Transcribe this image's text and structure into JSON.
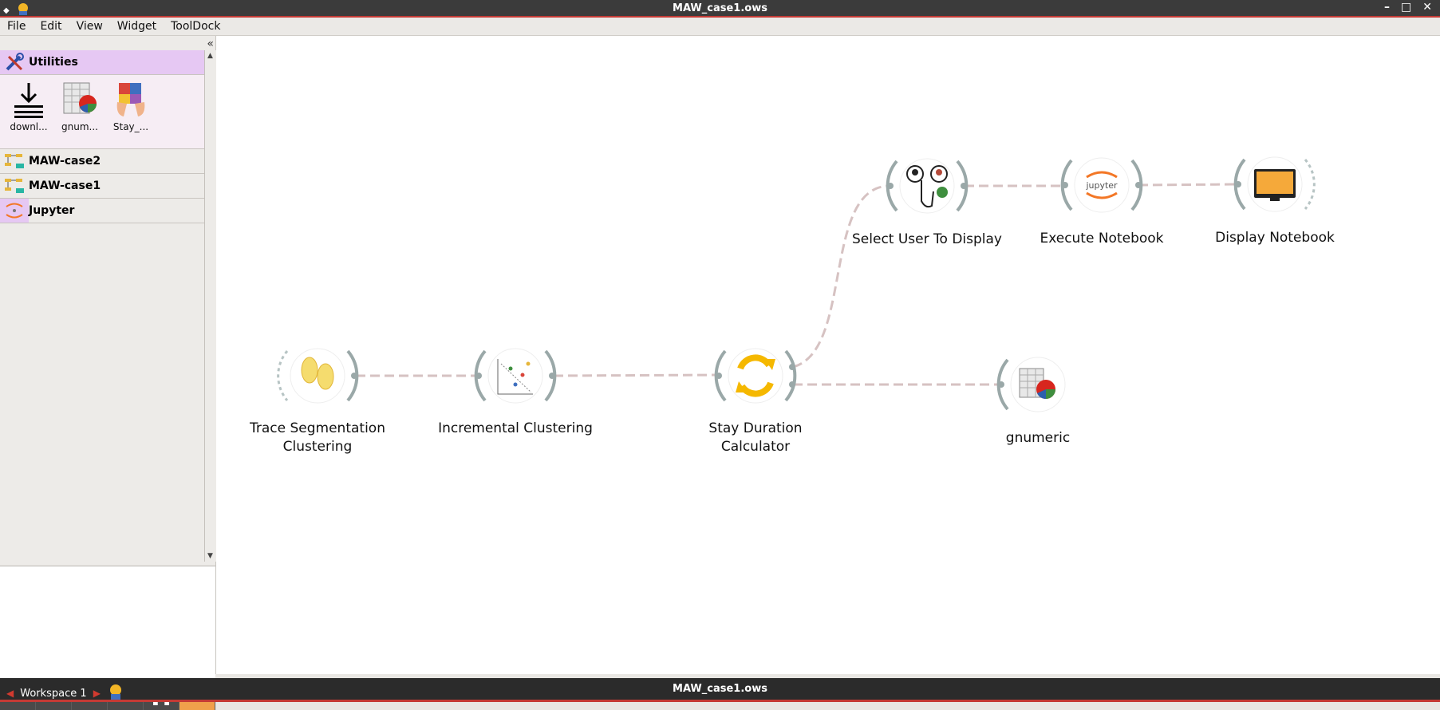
{
  "window": {
    "title": "MAW_case1.ows"
  },
  "menu": {
    "items": [
      "File",
      "Edit",
      "View",
      "Widget",
      "ToolDock"
    ]
  },
  "toolbox": {
    "categories": [
      {
        "name": "Utilities",
        "tools": [
          "downl...",
          "gnum...",
          "Stay_..."
        ]
      },
      {
        "name": "MAW-case2"
      },
      {
        "name": "MAW-case1"
      },
      {
        "name": "Jupyter"
      }
    ]
  },
  "nodes": {
    "trace": "Trace Segmentation\nClustering",
    "incremental": "Incremental Clustering",
    "stay": "Stay Duration\nCalculator",
    "select_user": "Select User To Display",
    "execute": "Execute Notebook",
    "display": "Display Notebook",
    "gnumeric": "gnumeric"
  },
  "taskbar": {
    "workspace": "Workspace 1",
    "window_title": "MAW_case1.ows"
  },
  "colors": {
    "accent": "#f0a04b",
    "category_active": "#e6c8f3",
    "link": "#d6c2c2",
    "node_ring": "#9aa8a8"
  }
}
